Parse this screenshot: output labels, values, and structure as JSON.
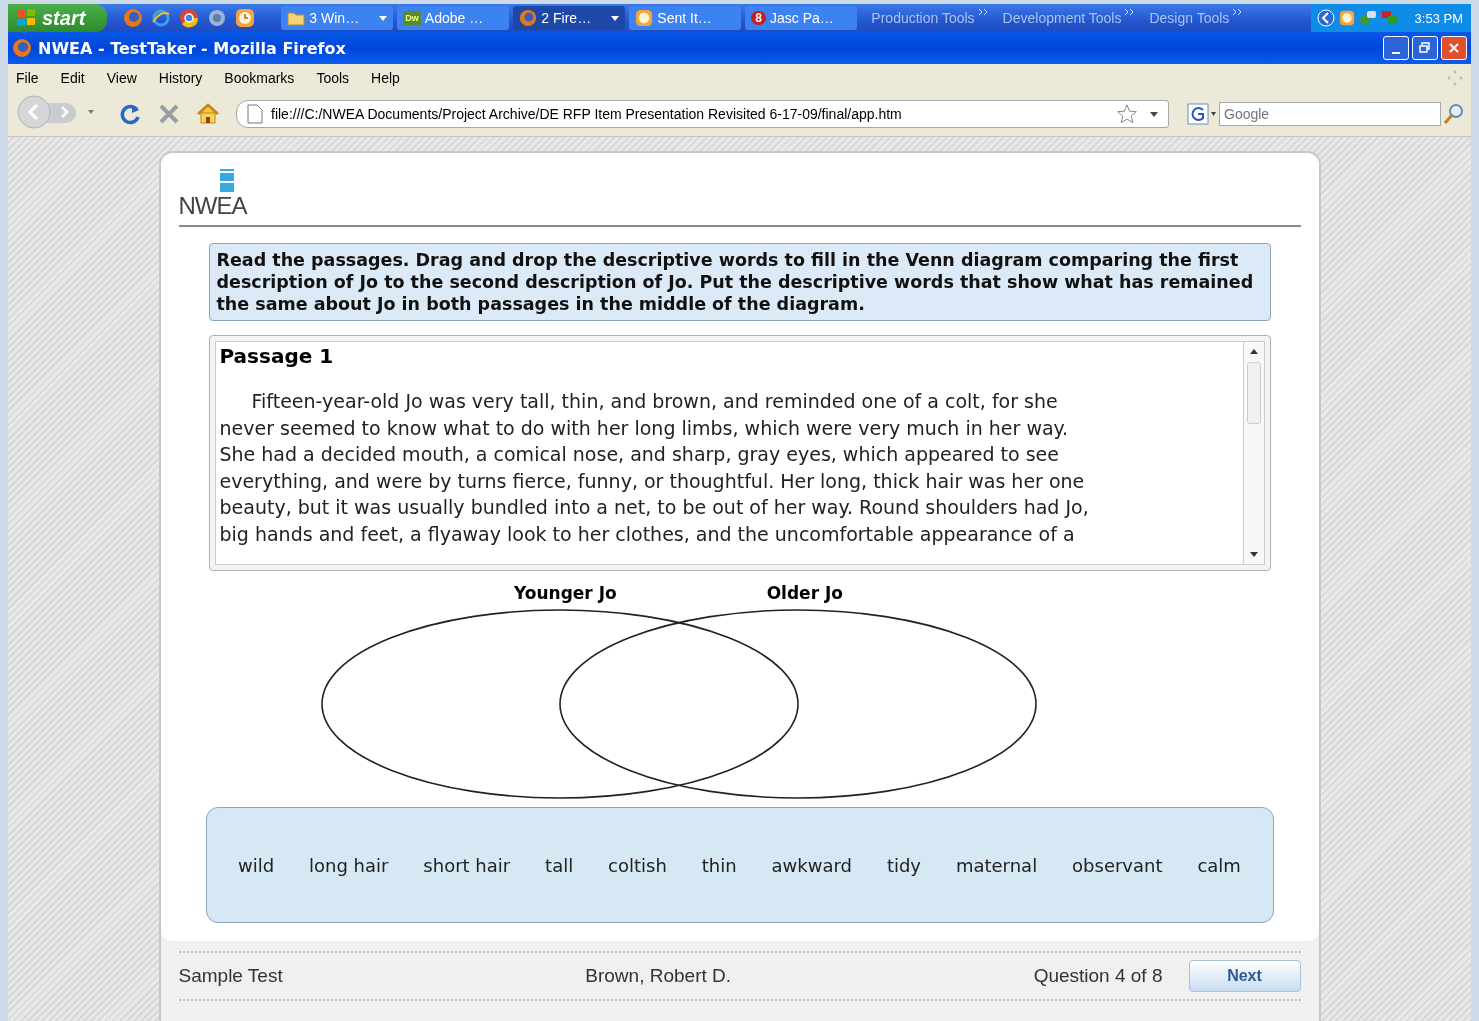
{
  "taskbar": {
    "start": "start",
    "tasks": [
      {
        "label": "3 Win…",
        "kind": "folder",
        "menu": true,
        "selected": false
      },
      {
        "label": "Adobe …",
        "kind": "dw",
        "badge": "Dw",
        "menu": false,
        "selected": false
      },
      {
        "label": "2 Fire…",
        "kind": "browser",
        "menu": true,
        "selected": true
      },
      {
        "label": "Sent It…",
        "kind": "mail",
        "menu": false,
        "selected": false
      },
      {
        "label": "Jasc Pa…",
        "kind": "jasc",
        "badge": "8",
        "menu": false,
        "selected": false
      }
    ],
    "toolbars": [
      "Production Tools",
      "Development Tools",
      "Design Tools"
    ],
    "clock": "3:53 PM"
  },
  "window": {
    "title": "NWEA - TestTaker - Mozilla Firefox"
  },
  "menu": [
    "File",
    "Edit",
    "View",
    "History",
    "Bookmarks",
    "Tools",
    "Help"
  ],
  "navbar": {
    "url": "file:///C:/NWEA Documents/Project Archive/DE RFP Item Presentation Revisited 6-17-09/final/app.htm",
    "search_placeholder": "Google"
  },
  "logo": "NWEA",
  "instructions": "Read the passages. Drag and drop the descriptive words to fill in the Venn diagram comparing the first description of Jo to the second description of Jo. Put the descriptive words that show what has remained the same about Jo in both passages in the middle of the diagram.",
  "passage": {
    "title": "Passage 1",
    "lines": [
      "Fifteen-year-old Jo was very tall, thin, and brown, and reminded one of a colt, for she",
      "never seemed to know what to do with her long limbs, which were very much in her way.",
      "She had a decided mouth, a comical nose, and sharp, gray eyes, which appeared to see",
      "everything, and were by turns fierce, funny, or thoughtful. Her long, thick hair was her one",
      "beauty, but it was usually bundled into a net, to be out of her way. Round shoulders had Jo,",
      "big hands and feet, a flyaway look to her clothes, and the uncomfortable appearance of a"
    ]
  },
  "venn": {
    "labels": [
      "Younger Jo",
      "Older Jo"
    ]
  },
  "word_bank": [
    "wild",
    "long hair",
    "short hair",
    "tall",
    "coltish",
    "thin",
    "awkward",
    "tidy",
    "maternal",
    "observant",
    "calm"
  ],
  "footer": {
    "test": "Sample Test",
    "student": "Brown, Robert D.",
    "progress": "Question 4 of 8",
    "next": "Next"
  }
}
